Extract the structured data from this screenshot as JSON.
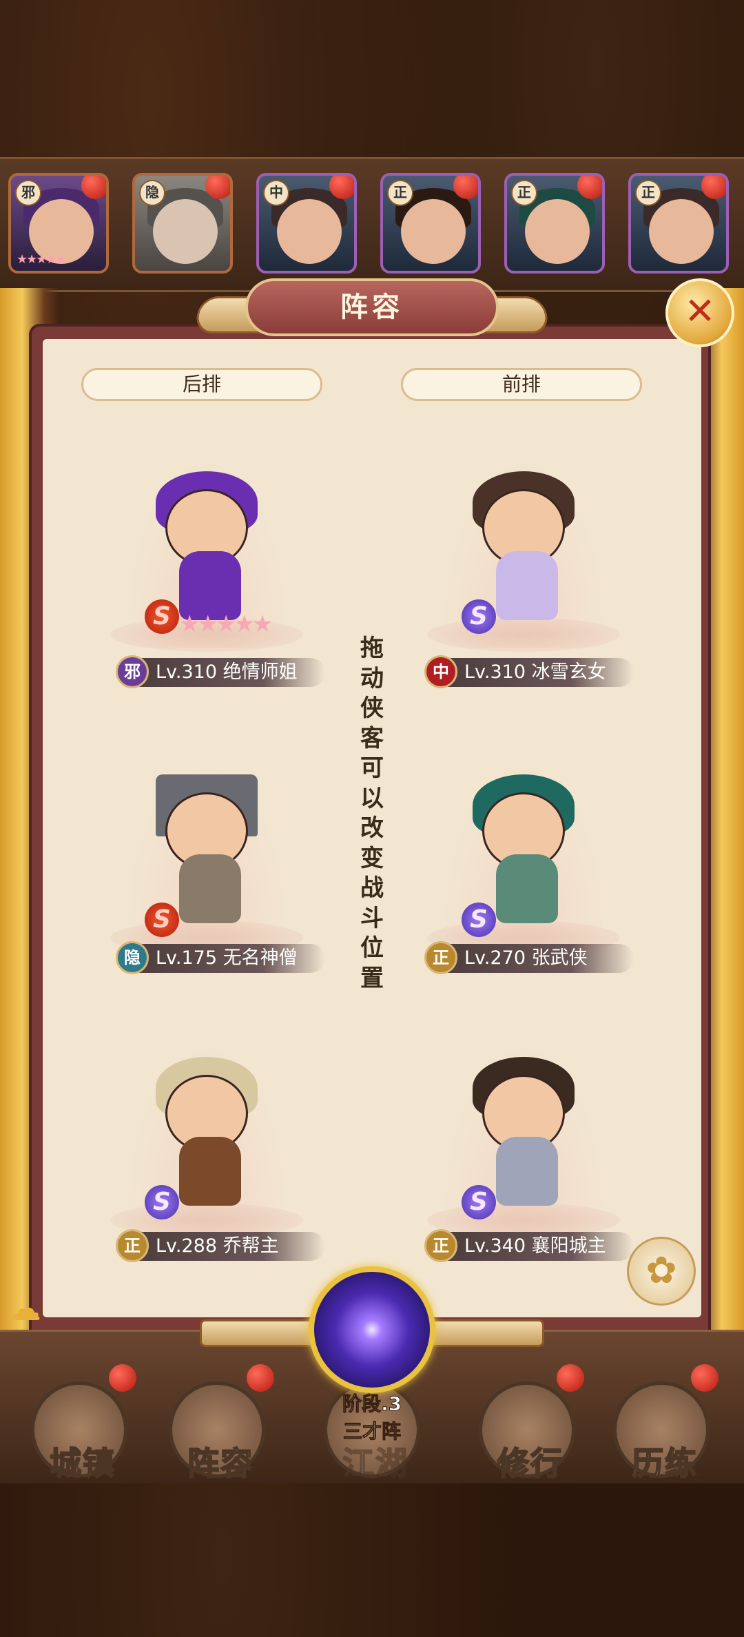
{
  "top_roster": [
    {
      "faction": "邪",
      "stars": "★★★★★"
    },
    {
      "faction": "隐",
      "stars": ""
    },
    {
      "faction": "中",
      "stars": ""
    },
    {
      "faction": "正",
      "stars": ""
    },
    {
      "faction": "正",
      "stars": ""
    },
    {
      "faction": "正",
      "stars": ""
    }
  ],
  "panel": {
    "title": "阵容",
    "close_icon": "✕",
    "back_row_label": "后排",
    "front_row_label": "前排",
    "hint": "拖动侠客可以改变战斗位置"
  },
  "formation": {
    "back": [
      {
        "faction": "邪",
        "level": "Lv.310",
        "name": "绝情师姐",
        "grade": "S",
        "stars": "★★★★★"
      },
      {
        "faction": "隐",
        "level": "Lv.175",
        "name": "无名神僧",
        "grade": "S",
        "stars": ""
      },
      {
        "faction": "正",
        "level": "Lv.288",
        "name": "乔帮主",
        "grade": "S",
        "stars": ""
      }
    ],
    "front": [
      {
        "faction": "中",
        "level": "Lv.310",
        "name": "冰雪玄女",
        "grade": "S",
        "stars": ""
      },
      {
        "faction": "正",
        "level": "Lv.270",
        "name": "张武侠",
        "grade": "S",
        "stars": ""
      },
      {
        "faction": "正",
        "level": "Lv.340",
        "name": "襄阳城主",
        "grade": "S",
        "stars": ""
      }
    ]
  },
  "formation_type": {
    "stage": "阶段.3",
    "name": "三才阵"
  },
  "bottom_nav": [
    {
      "label": "城镇"
    },
    {
      "label": "阵容"
    },
    {
      "label": "江湖"
    },
    {
      "label": "修行"
    },
    {
      "label": "历练"
    }
  ]
}
